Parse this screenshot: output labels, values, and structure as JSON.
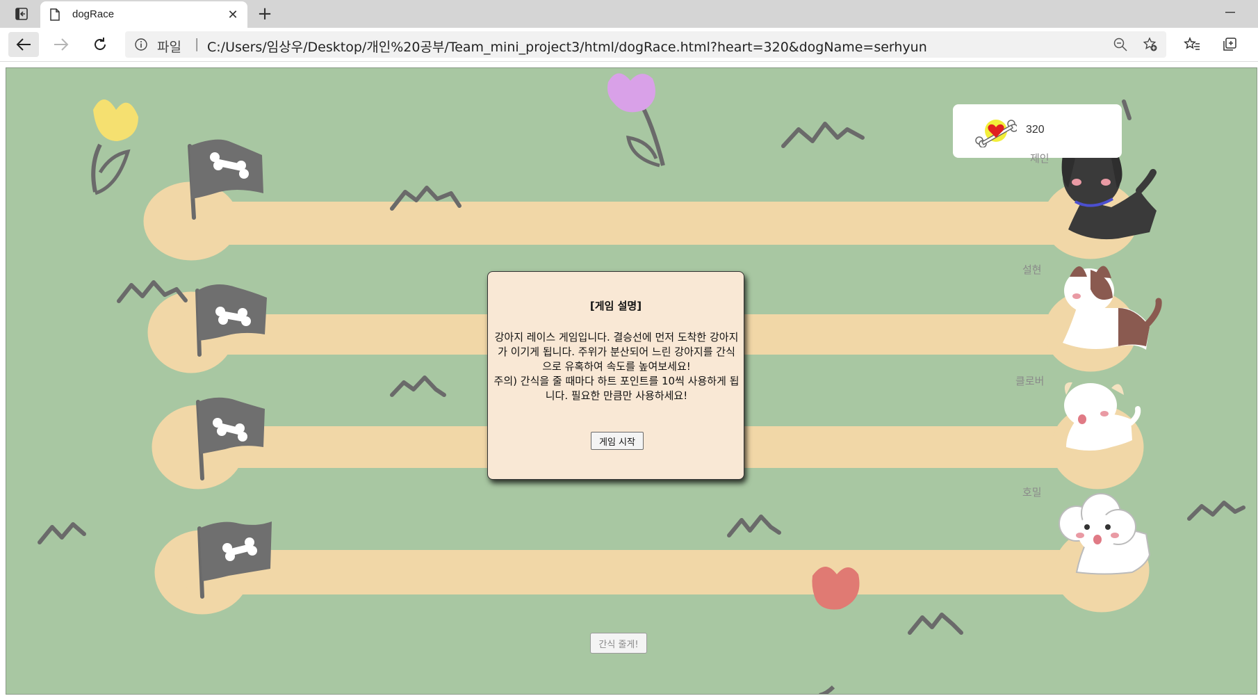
{
  "browser": {
    "tab_title": "dogRace",
    "address_scheme": "파일",
    "address_separator": "|",
    "url": "C:/Users/임상우/Desktop/개인%20공부/Team_mini_project3/html/dogRace.html?heart=320&dogName=serhyun",
    "icons": [
      "tab-actions-icon",
      "page-icon",
      "close-icon",
      "plus-icon",
      "minimize-icon",
      "back-arrow-icon",
      "forward-arrow-icon",
      "reload-icon",
      "info-icon",
      "zoom-out-icon",
      "add-favorite-icon",
      "favorites-icon",
      "collections-icon"
    ]
  },
  "game": {
    "heart_count": "320",
    "dogs": [
      {
        "name": "제인",
        "color": "#3a3a3a"
      },
      {
        "name": "설현",
        "color": "#8a5a50"
      },
      {
        "name": "클로버",
        "color": "#f4e2c0"
      },
      {
        "name": "호밀",
        "color": "#ffffff"
      }
    ],
    "snack_button": "간식 줄게!",
    "colors": {
      "grass": "#a8c7a2",
      "track": "#f1d7a7",
      "flag": "#6f6f6f",
      "modal_bg": "#f9e8d5"
    }
  },
  "modal": {
    "title": "[게임 설명]",
    "line1": "강아지 레이스 게임입니다. 결승선에 먼저 도착한 강아지가 이기게 됩니다. 주위가 분산되어 느린 강아지를 간식으로 유혹하여 속도를 높여보세요!",
    "line2": "주의) 간식을 줄 때마다 하트 포인트를 10씩 사용하게 됩니다. 필요한 만큼만 사용하세요!",
    "start_button": "게임 시작"
  }
}
